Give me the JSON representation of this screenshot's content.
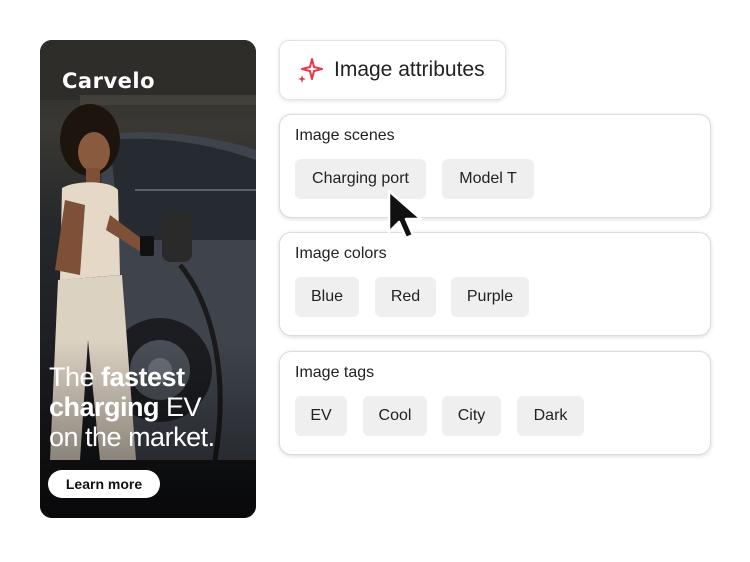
{
  "ad": {
    "logo": "Carvelo",
    "headline_part1": "The ",
    "headline_bold1": "fastest",
    "headline_bold2": "charging",
    "headline_part2": " EV",
    "headline_part3": "on the market.",
    "cta_label": "Learn more"
  },
  "header": {
    "title": "Image attributes",
    "icon": "sparkle-icon"
  },
  "sections": {
    "scenes": {
      "title": "Image scenes",
      "chips": [
        "Charging port",
        "Model T"
      ]
    },
    "colors": {
      "title": "Image colors",
      "chips": [
        "Blue",
        "Red",
        "Purple"
      ]
    },
    "tags": {
      "title": "Image tags",
      "chips": [
        "EV",
        "Cool",
        "City",
        "Dark"
      ]
    }
  },
  "colors": {
    "sparkle": "#e8384f",
    "chip_bg": "#efefef",
    "cta_bg": "#ffffff"
  }
}
